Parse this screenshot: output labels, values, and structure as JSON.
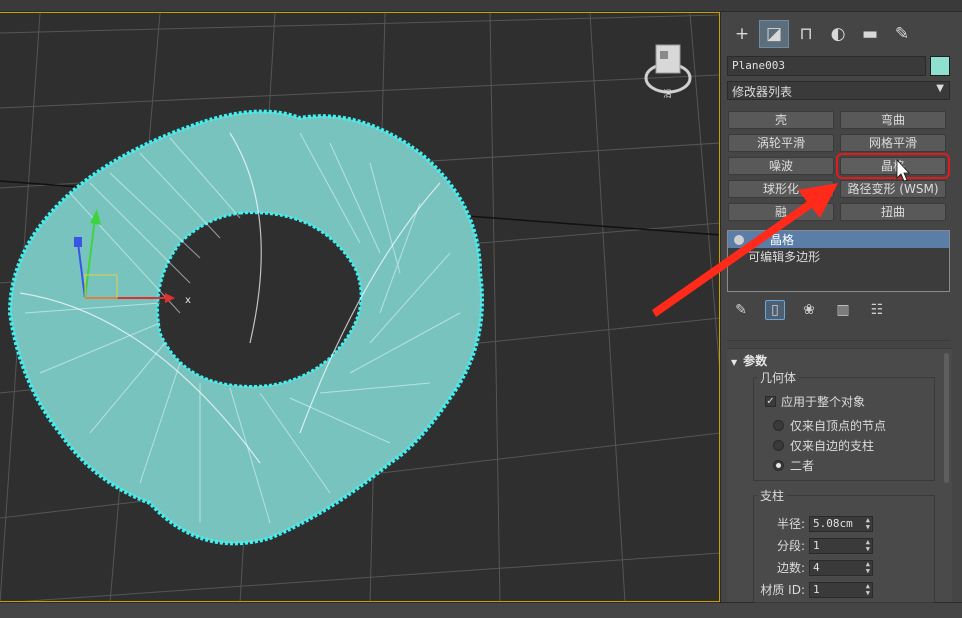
{
  "viewport": {
    "axis_x_label": "x",
    "viewcube_label": "滑"
  },
  "panel": {
    "tabs": [
      {
        "icon": "plus-icon",
        "glyph": "+"
      },
      {
        "icon": "modify-icon",
        "glyph": "◪"
      },
      {
        "icon": "hierarchy-icon",
        "glyph": "⊓"
      },
      {
        "icon": "motion-icon",
        "glyph": "◐"
      },
      {
        "icon": "display-icon",
        "glyph": "▬"
      },
      {
        "icon": "utilities-icon",
        "glyph": "✎"
      }
    ],
    "object_name": "Plane003",
    "object_color": "#8fe0cf",
    "modifier_list": "修改器列表",
    "modifier_buttons": [
      {
        "label": "壳"
      },
      {
        "label": "弯曲"
      },
      {
        "label": "涡轮平滑"
      },
      {
        "label": "网格平滑"
      },
      {
        "label": "噪波"
      },
      {
        "label": "晶格"
      },
      {
        "label": "球形化"
      },
      {
        "label": "路径变形 (WSM)"
      },
      {
        "label": "融"
      },
      {
        "label": "扭曲"
      }
    ],
    "stack": [
      {
        "label": "晶格"
      },
      {
        "label": "可编辑多边形"
      }
    ],
    "params": {
      "title": "参数",
      "geometry_group": "几何体",
      "apply_whole": "应用于整个对象",
      "radio_vertices": "仅来自顶点的节点",
      "radio_edges": "仅来自边的支柱",
      "radio_both": "二者",
      "struts_group": "支柱",
      "radius_label": "半径:",
      "radius_value": "5.08cm",
      "segments_label": "分段:",
      "segments_value": "1",
      "sides_label": "边数:",
      "sides_value": "4",
      "matid_label": "材质 ID:",
      "matid_value": "1"
    }
  },
  "colors": {
    "highlight": "#e31a1a",
    "selection": "#5a7ea8",
    "mesh": "#8fd6d2"
  }
}
